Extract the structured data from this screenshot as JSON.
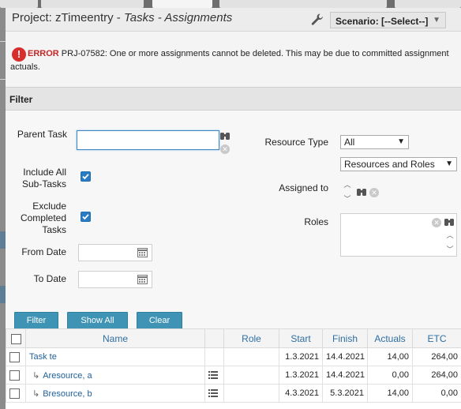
{
  "title": {
    "project_prefix": "Project: zTimeentry - ",
    "section": "Tasks - Assignments"
  },
  "toolbar": {
    "scenario": "Scenario: [--Select--]"
  },
  "error": {
    "label": "ERROR",
    "message": " PRJ-07582: One or more assignments cannot be deleted. This may be due to committed assignment actuals."
  },
  "filter": {
    "header": "Filter",
    "parent_task_label": "Parent Task",
    "parent_task_value": "",
    "include_all_label": "Include All Sub-Tasks",
    "include_all_checked": true,
    "exclude_completed_label": "Exclude Completed Tasks",
    "exclude_completed_checked": true,
    "from_date_label": "From Date",
    "from_date_value": "",
    "to_date_label": "To Date",
    "to_date_value": "",
    "resource_type_label": "Resource Type",
    "resource_type_value": "All",
    "resource_role_value": "Resources and Roles",
    "assigned_to_label": "Assigned to",
    "roles_label": "Roles",
    "buttons": {
      "filter": "Filter",
      "show_all": "Show All",
      "clear": "Clear"
    }
  },
  "grid": {
    "columns": [
      "Name",
      "Role",
      "Start",
      "Finish",
      "Actuals",
      "ETC"
    ],
    "rows": [
      {
        "name": "Task te",
        "child": false,
        "role": "",
        "start": "1.3.2021",
        "finish": "14.4.2021",
        "actuals": "14,00",
        "etc": "264,00"
      },
      {
        "name": "Aresource, a",
        "child": true,
        "role": "",
        "start": "1.3.2021",
        "finish": "14.4.2021",
        "actuals": "0,00",
        "etc": "264,00"
      },
      {
        "name": "Bresource, b",
        "child": true,
        "role": "",
        "start": "4.3.2021",
        "finish": "5.3.2021",
        "actuals": "14,00",
        "etc": "0,00"
      }
    ]
  },
  "icons": {
    "error": "exclamation-circle-icon",
    "wrench": "wrench-icon",
    "lookup": "binoculars-icon",
    "clear": "clear-x-icon",
    "calendar": "calendar-icon",
    "indent": "child-row-arrow-icon",
    "details": "list-details-icon"
  },
  "colors": {
    "error": "#c52727",
    "button": "#3f93b5",
    "checkbox": "#2b7bc2",
    "link": "#1f5f9a",
    "column_header": "#2e6ea2"
  }
}
